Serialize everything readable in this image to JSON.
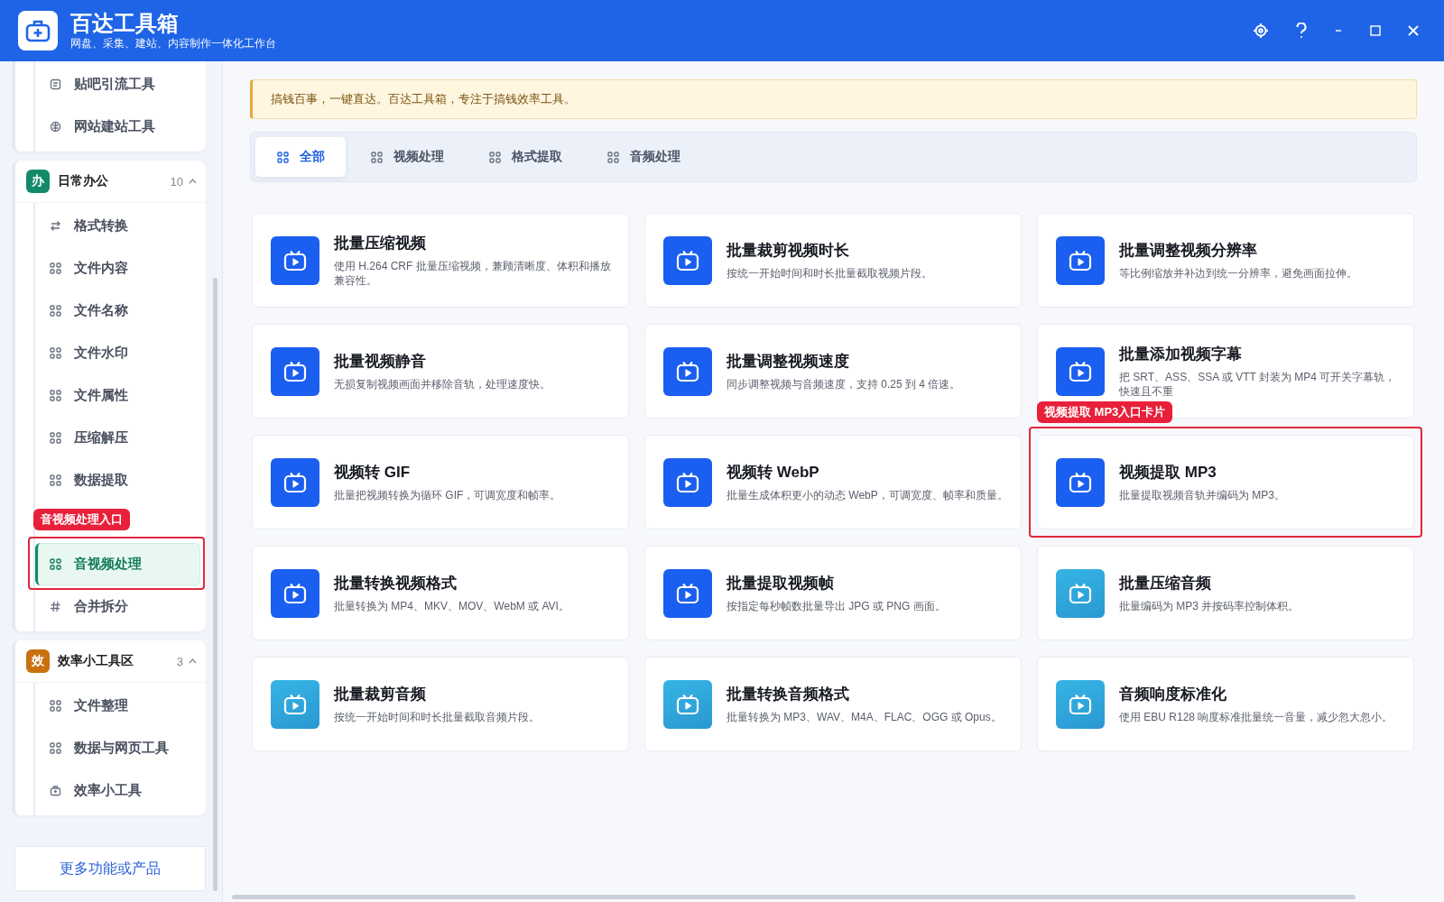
{
  "header": {
    "title": "百达工具箱",
    "subtitle": "网盘、采集、建站、内容制作一体化工作台"
  },
  "sidebar": {
    "groups": [
      {
        "items": [
          {
            "label": "贴吧引流工具",
            "kind": "note",
            "selected": false
          },
          {
            "label": "网站建站工具",
            "kind": "web",
            "selected": false
          }
        ]
      },
      {
        "badge": "办",
        "color": "#138a6a",
        "title": "日常办公",
        "count": "10",
        "expanded": true,
        "items": [
          {
            "label": "格式转换",
            "kind": "swap",
            "selected": false
          },
          {
            "label": "文件内容",
            "kind": "grid",
            "selected": false
          },
          {
            "label": "文件名称",
            "kind": "grid",
            "selected": false
          },
          {
            "label": "文件水印",
            "kind": "grid",
            "selected": false
          },
          {
            "label": "文件属性",
            "kind": "grid",
            "selected": false
          },
          {
            "label": "压缩解压",
            "kind": "grid",
            "selected": false
          },
          {
            "label": "数据提取",
            "kind": "grid",
            "selected": false
          },
          {
            "label": "音视频处理",
            "kind": "grid",
            "selected": true,
            "callout": "音视频处理入口"
          },
          {
            "label": "合并拆分",
            "kind": "hash",
            "selected": false
          }
        ]
      },
      {
        "badge": "效",
        "color": "#c8710f",
        "title": "效率小工具区",
        "count": "3",
        "expanded": true,
        "items": [
          {
            "label": "文件整理",
            "kind": "grid",
            "selected": false
          },
          {
            "label": "数据与网页工具",
            "kind": "grid",
            "selected": false
          },
          {
            "label": "效率小工具",
            "kind": "toolbox",
            "selected": false
          }
        ]
      }
    ],
    "more_button": "更多功能或产品"
  },
  "notice": "搞钱百事，一键直达。百达工具箱，专注于搞钱效率工具。",
  "tabs": [
    {
      "label": "全部",
      "selected": true
    },
    {
      "label": "视频处理",
      "selected": false
    },
    {
      "label": "格式提取",
      "selected": false
    },
    {
      "label": "音频处理",
      "selected": false
    }
  ],
  "cards": [
    {
      "kind": "video",
      "title": "批量压缩视频",
      "description": "使用 H.264 CRF 批量压缩视频，兼顾清晰度、体积和播放兼容性。"
    },
    {
      "kind": "video",
      "title": "批量裁剪视频时长",
      "description": "按统一开始时间和时长批量截取视频片段。"
    },
    {
      "kind": "video",
      "title": "批量调整视频分辨率",
      "description": "等比例缩放并补边到统一分辨率，避免画面拉伸。"
    },
    {
      "kind": "video",
      "title": "批量视频静音",
      "description": "无损复制视频画面并移除音轨，处理速度快。"
    },
    {
      "kind": "video",
      "title": "批量调整视频速度",
      "description": "同步调整视频与音频速度，支持 0.25 到 4 倍速。"
    },
    {
      "kind": "video",
      "title": "批量添加视频字幕",
      "description": "把 SRT、ASS、SSA 或 VTT 封装为 MP4 可开关字幕轨，快速且不重"
    },
    {
      "kind": "video",
      "title": "视频转 GIF",
      "description": "批量把视频转换为循环 GIF，可调宽度和帧率。"
    },
    {
      "kind": "video",
      "title": "视频转 WebP",
      "description": "批量生成体积更小的动态 WebP，可调宽度、帧率和质量。"
    },
    {
      "kind": "video",
      "title": "视频提取 MP3",
      "description": "批量提取视频音轨并编码为 MP3。",
      "callout": "视频提取 MP3入口卡片"
    },
    {
      "kind": "video",
      "title": "批量转换视频格式",
      "description": "批量转换为 MP4、MKV、MOV、WebM 或 AVI。"
    },
    {
      "kind": "video",
      "title": "批量提取视频帧",
      "description": "按指定每秒帧数批量导出 JPG 或 PNG 画面。"
    },
    {
      "kind": "audio",
      "title": "批量压缩音频",
      "description": "批量编码为 MP3 并按码率控制体积。"
    },
    {
      "kind": "audio",
      "title": "批量裁剪音频",
      "description": "按统一开始时间和时长批量截取音频片段。"
    },
    {
      "kind": "audio",
      "title": "批量转换音频格式",
      "description": "批量转换为 MP3、WAV、M4A、FLAC、OGG 或 Opus。"
    },
    {
      "kind": "audio",
      "title": "音频响度标准化",
      "description": "使用 EBU R128 响度标准批量统一音量，减少忽大忽小。"
    }
  ]
}
